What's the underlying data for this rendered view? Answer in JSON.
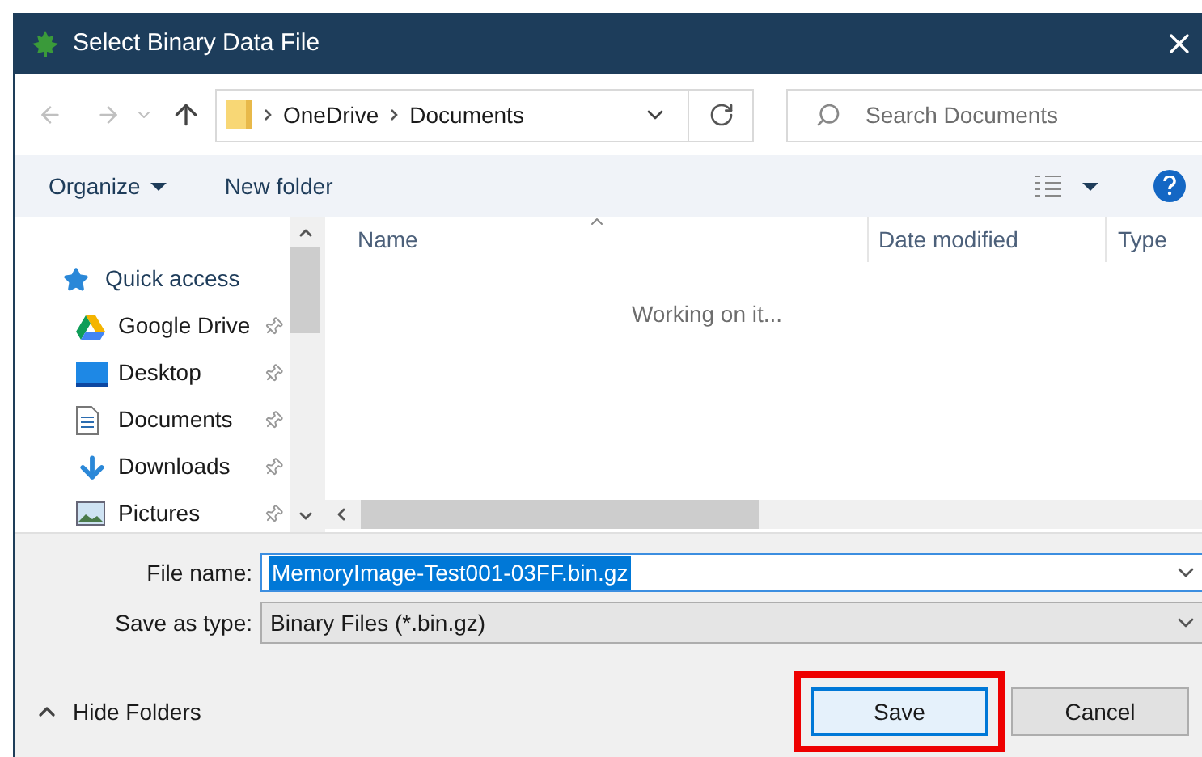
{
  "window": {
    "title": "Select Binary Data File"
  },
  "address_bar": {
    "breadcrumbs": [
      "OneDrive",
      "Documents"
    ]
  },
  "search": {
    "placeholder": "Search Documents"
  },
  "toolbar": {
    "commands": [
      {
        "label": "Organize",
        "dropdown": true
      },
      {
        "label": "New folder",
        "dropdown": false
      }
    ]
  },
  "nav_pane": {
    "items": [
      {
        "kind": "header",
        "label": "Quick access",
        "pinned": false
      },
      {
        "kind": "item",
        "label": "Google Drive",
        "pinned": true
      },
      {
        "kind": "item",
        "label": "Desktop",
        "pinned": true
      },
      {
        "kind": "item",
        "label": "Documents",
        "pinned": true
      },
      {
        "kind": "item",
        "label": "Downloads",
        "pinned": true
      },
      {
        "kind": "item",
        "label": "Pictures",
        "pinned": true
      }
    ]
  },
  "file_list": {
    "columns": [
      {
        "label": "Name",
        "sorted": true
      },
      {
        "label": "Date modified",
        "sorted": false
      },
      {
        "label": "Type",
        "sorted": false
      }
    ],
    "status": "Working on it..."
  },
  "file_name": {
    "label": "File name:",
    "value": "MemoryImage-Test001-03FF.bin.gz",
    "selected": true
  },
  "save_as_type": {
    "label": "Save as type:",
    "value": "Binary Files (*.bin.gz)"
  },
  "hide_folders": {
    "label": "Hide Folders"
  },
  "buttons": [
    {
      "label": "Save",
      "default": true,
      "highlighted": true
    },
    {
      "label": "Cancel",
      "default": false,
      "highlighted": false
    }
  ]
}
